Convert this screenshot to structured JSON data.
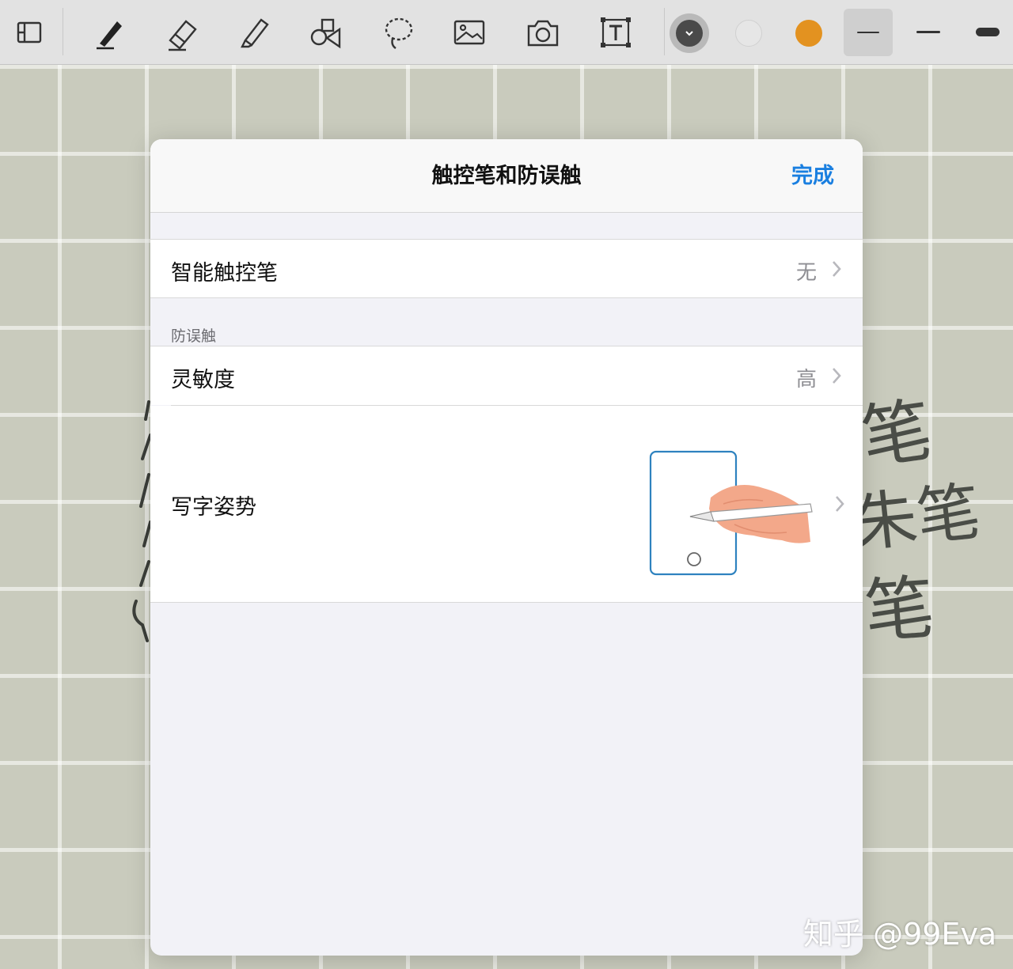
{
  "toolbar": {
    "tools": [
      {
        "name": "page-layout-icon"
      },
      {
        "name": "pen-icon"
      },
      {
        "name": "eraser-icon"
      },
      {
        "name": "highlighter-icon"
      },
      {
        "name": "shapes-icon"
      },
      {
        "name": "lasso-icon"
      },
      {
        "name": "image-icon"
      },
      {
        "name": "camera-icon"
      },
      {
        "name": "text-box-icon"
      }
    ],
    "colors": [
      "#4a4a4a",
      "#e6e6e6",
      "#e39220"
    ],
    "selected_color": "#4a4a4a"
  },
  "modal": {
    "title": "触控笔和防误触",
    "done_label": "完成",
    "stylus": {
      "label": "智能触控笔",
      "value": "无"
    },
    "section_header": "防误触",
    "sensitivity": {
      "label": "灵敏度",
      "value": "高"
    },
    "posture": {
      "label": "写字姿势"
    }
  },
  "background": {
    "scribbles": [
      "笔",
      "朱笔",
      "笔"
    ]
  },
  "watermark": "知乎 @99Eva"
}
